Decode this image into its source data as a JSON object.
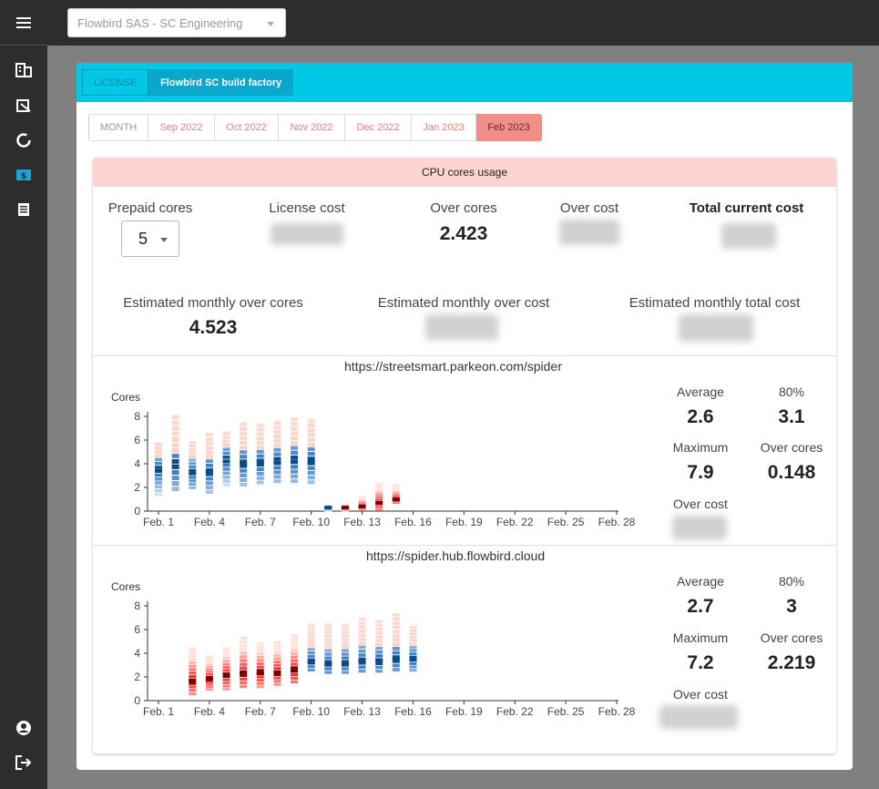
{
  "org_select": {
    "value": "Flowbird SAS - SC Engineering"
  },
  "license_tabs": [
    {
      "label": "LICENSE"
    },
    {
      "label": "Flowbird SC build factory"
    }
  ],
  "month_tabs": [
    {
      "label": "MONTH"
    },
    {
      "label": "Sep 2022"
    },
    {
      "label": "Oct 2022"
    },
    {
      "label": "Nov 2022"
    },
    {
      "label": "Dec 2022"
    },
    {
      "label": "Jan 2023"
    },
    {
      "label": "Feb 2023"
    }
  ],
  "usage": {
    "title": "CPU cores usage",
    "prepaid_label": "Prepaid cores",
    "prepaid_value": "5",
    "license_cost_label": "License cost",
    "over_cores_label": "Over cores",
    "over_cores_value": "2.423",
    "over_cost_label": "Over cost",
    "total_cost_label": "Total current cost",
    "est_over_cores_label": "Estimated monthly over cores",
    "est_over_cores_value": "4.523",
    "est_over_cost_label": "Estimated monthly over cost",
    "est_total_cost_label": "Estimated monthly total cost"
  },
  "sites": [
    {
      "url": "https://streetsmart.parkeon.com/spider",
      "stats": {
        "average_label": "Average",
        "average": "2.6",
        "p80_label": "80%",
        "p80": "3.1",
        "maximum_label": "Maximum",
        "maximum": "7.9",
        "over_cores_label": "Over cores",
        "over_cores": "0.148",
        "over_cost_label": "Over cost"
      }
    },
    {
      "url": "https://spider.hub.flowbird.cloud",
      "stats": {
        "average_label": "Average",
        "average": "2.7",
        "p80_label": "80%",
        "p80": "3",
        "maximum_label": "Maximum",
        "maximum": "7.2",
        "over_cores_label": "Over cores",
        "over_cores": "2.219",
        "over_cost_label": "Over cost"
      }
    }
  ],
  "chart_data": [
    {
      "type": "heatmap",
      "ylabel": "Cores",
      "ylim": [
        0,
        8
      ],
      "yticks": [
        "0",
        "2",
        "4",
        "6",
        "8"
      ],
      "xticks": [
        "Feb. 1",
        "Feb. 4",
        "Feb. 7",
        "Feb. 10",
        "Feb. 13",
        "Feb. 16",
        "Feb. 19",
        "Feb. 22",
        "Feb. 25",
        "Feb. 28"
      ],
      "columns": [
        {
          "day": 1,
          "low": 1.2,
          "high": 5.8,
          "median": 3.4,
          "over": false
        },
        {
          "day": 2,
          "low": 1.6,
          "high": 8.1,
          "median": 3.8,
          "over": false
        },
        {
          "day": 3,
          "low": 1.8,
          "high": 5.9,
          "median": 3.2,
          "over": false
        },
        {
          "day": 4,
          "low": 1.4,
          "high": 6.6,
          "median": 3.3,
          "over": false
        },
        {
          "day": 5,
          "low": 2.0,
          "high": 6.7,
          "median": 4.2,
          "over": false
        },
        {
          "day": 6,
          "low": 2.0,
          "high": 7.5,
          "median": 4.0,
          "over": false
        },
        {
          "day": 7,
          "low": 2.2,
          "high": 7.4,
          "median": 4.1,
          "over": false
        },
        {
          "day": 8,
          "low": 2.3,
          "high": 7.6,
          "median": 4.1,
          "over": false
        },
        {
          "day": 9,
          "low": 2.3,
          "high": 7.9,
          "median": 4.2,
          "over": false
        },
        {
          "day": 10,
          "low": 2.2,
          "high": 7.8,
          "median": 4.2,
          "over": false
        },
        {
          "day": 11,
          "low": 0.0,
          "high": 0.5,
          "median": 0.3,
          "over": false
        },
        {
          "day": 12,
          "low": 0.0,
          "high": 0.6,
          "median": 0.3,
          "over": true
        },
        {
          "day": 13,
          "low": 0.0,
          "high": 1.3,
          "median": 0.4,
          "over": true
        },
        {
          "day": 14,
          "low": 0.0,
          "high": 2.4,
          "median": 0.7,
          "over": true
        },
        {
          "day": 15,
          "low": 0.6,
          "high": 2.3,
          "median": 1.0,
          "over": true
        }
      ]
    },
    {
      "type": "heatmap",
      "ylabel": "Cores",
      "ylim": [
        0,
        8
      ],
      "yticks": [
        "0",
        "2",
        "4",
        "6",
        "8"
      ],
      "xticks": [
        "Feb. 1",
        "Feb. 4",
        "Feb. 7",
        "Feb. 10",
        "Feb. 13",
        "Feb. 16",
        "Feb. 19",
        "Feb. 22",
        "Feb. 25",
        "Feb. 28"
      ],
      "columns": [
        {
          "day": 3,
          "low": 0.4,
          "high": 4.5,
          "median": 1.7,
          "over": true
        },
        {
          "day": 4,
          "low": 0.8,
          "high": 3.8,
          "median": 1.8,
          "over": true
        },
        {
          "day": 5,
          "low": 0.8,
          "high": 4.5,
          "median": 2.1,
          "over": true
        },
        {
          "day": 6,
          "low": 1.0,
          "high": 5.4,
          "median": 2.3,
          "over": true
        },
        {
          "day": 7,
          "low": 1.0,
          "high": 4.9,
          "median": 2.3,
          "over": true
        },
        {
          "day": 8,
          "low": 1.2,
          "high": 5.0,
          "median": 2.4,
          "over": true
        },
        {
          "day": 9,
          "low": 1.4,
          "high": 5.6,
          "median": 2.5,
          "over": true
        },
        {
          "day": 10,
          "low": 2.4,
          "high": 6.5,
          "median": 3.3,
          "over": false
        },
        {
          "day": 11,
          "low": 2.2,
          "high": 6.5,
          "median": 3.1,
          "over": false
        },
        {
          "day": 12,
          "low": 2.2,
          "high": 6.5,
          "median": 3.2,
          "over": false
        },
        {
          "day": 13,
          "low": 2.3,
          "high": 7.0,
          "median": 3.3,
          "over": false
        },
        {
          "day": 14,
          "low": 2.3,
          "high": 6.8,
          "median": 3.4,
          "over": false
        },
        {
          "day": 15,
          "low": 2.4,
          "high": 7.4,
          "median": 3.5,
          "over": false
        },
        {
          "day": 16,
          "low": 2.4,
          "high": 6.3,
          "median": 3.5,
          "over": false
        }
      ]
    }
  ]
}
